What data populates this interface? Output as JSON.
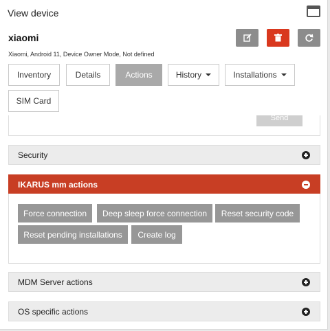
{
  "header": {
    "title": "View device"
  },
  "device": {
    "name": "xiaomi",
    "info": "Xiaomi, Android 11, Device Owner Mode, Not defined"
  },
  "icons": {
    "edit": "edit-icon",
    "delete": "trash-icon",
    "refresh": "refresh-icon",
    "window": "window-icon"
  },
  "tabs": [
    {
      "label": "Inventory"
    },
    {
      "label": "Details"
    },
    {
      "label": "Actions",
      "active": true
    },
    {
      "label": "History",
      "dropdown": true
    },
    {
      "label": "Installations",
      "dropdown": true
    },
    {
      "label": "SIM Card"
    }
  ],
  "send_label": "Send",
  "sections": {
    "security": "Security",
    "ikarus": "IKARUS mm actions",
    "mdm": "MDM Server actions",
    "os": "OS specific actions"
  },
  "ikarus_actions": [
    "Force connection",
    "Deep sleep force connection",
    "Reset security code",
    "Reset pending installations",
    "Create log"
  ],
  "colors": {
    "accent_red": "#d9381e",
    "section_red": "#c83e24",
    "button_gray": "#979797"
  }
}
